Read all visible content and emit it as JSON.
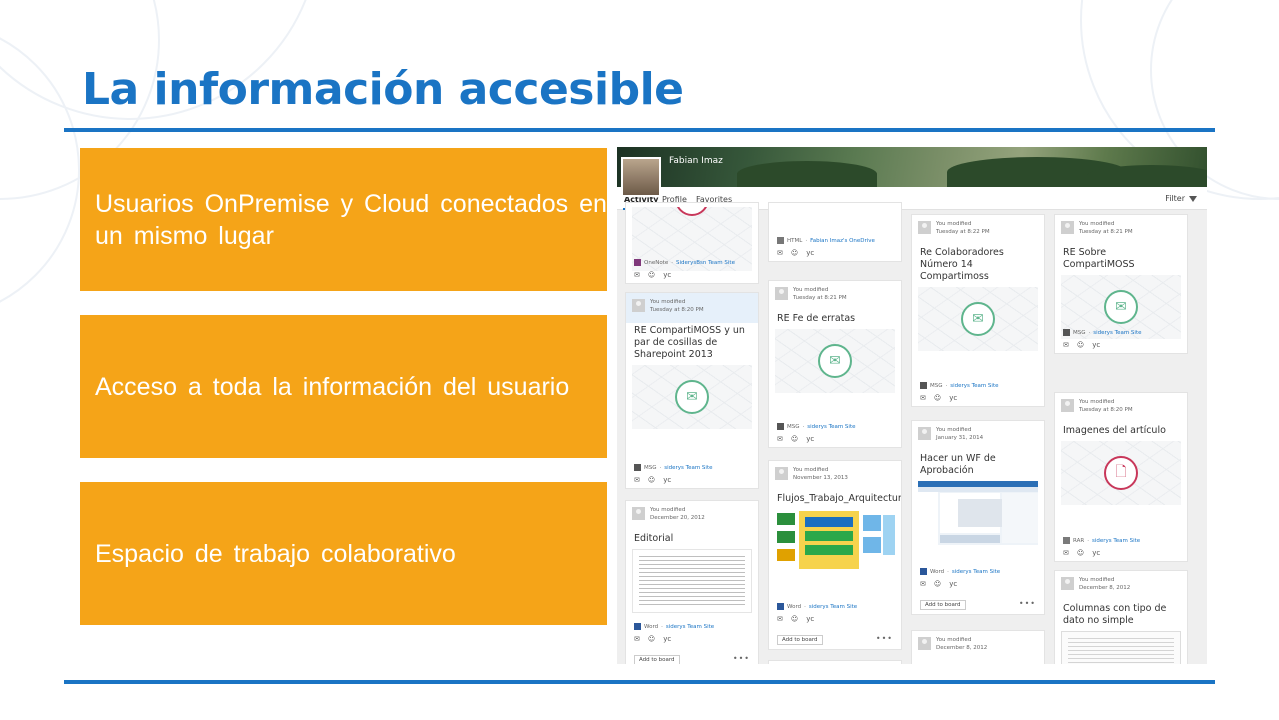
{
  "slide": {
    "title": "La información accesible",
    "colors": {
      "accent": "#1a74c4",
      "box": "#f5a418"
    },
    "boxes": [
      "Usuarios OnPremise y Cloud conectados en un mismo lugar",
      "Acceso a toda la información del usuario",
      "Espacio de trabajo colaborativo"
    ]
  },
  "profile": {
    "name": "Fabian Imaz",
    "tabs": [
      "Activity",
      "Profile",
      "Favorites"
    ],
    "filter_label": "Filter",
    "actions_glyph": "yc",
    "add_to_board": "Add to board",
    "more_glyph": "•••"
  },
  "columns": [
    [
      {
        "title": "",
        "modified": "",
        "date": "",
        "source_type": "OneNote",
        "source_icon": "onenote-icon",
        "site": "SiderysBsn Team Site",
        "preview": "partial-ring",
        "add": false
      },
      {
        "title": "RE CompartiMOSS y un par de cosillas de Sharepoint 2013",
        "modified": "You modified",
        "date": "Tuesday at 8:20 PM",
        "source_type": "MSG",
        "source_icon": "mail-icon",
        "site": "siderys Team Site",
        "preview": "mail-ring",
        "add": false,
        "highlight": true
      },
      {
        "title": "Editorial",
        "modified": "You modified",
        "date": "December 20, 2012",
        "source_type": "Word",
        "source_icon": "word-icon",
        "site": "siderys Team Site",
        "preview": "document",
        "add": true
      }
    ],
    [
      {
        "title": "",
        "modified": "",
        "date": "",
        "source_type": "HTML",
        "source_icon": "html-file-icon",
        "site": "Fabian Imaz's OneDrive",
        "preview": "none",
        "add": false
      },
      {
        "title": "RE Fe de erratas",
        "modified": "You modified",
        "date": "Tuesday at 8:21 PM",
        "source_type": "MSG",
        "source_icon": "mail-icon",
        "site": "siderys Team Site",
        "preview": "mail-ring",
        "add": false
      },
      {
        "title": "Flujos_Trabajo_Arquitectura",
        "modified": "You modified",
        "date": "November 13, 2013",
        "source_type": "Word",
        "source_icon": "word-icon",
        "site": "siderys Team Site",
        "preview": "flowchart",
        "add": true
      },
      {
        "title": "",
        "modified": "",
        "date": "",
        "source_type": "",
        "source_icon": "",
        "site": "",
        "preview": "none",
        "add": false
      }
    ],
    [
      {
        "title": "Re Colaboradores Número 14 Compartimoss",
        "modified": "You modified",
        "date": "Tuesday at 8:22 PM",
        "source_type": "MSG",
        "source_icon": "mail-icon",
        "site": "siderys Team Site",
        "preview": "mail-ring",
        "add": false
      },
      {
        "title": "Hacer un WF de Aprobación",
        "modified": "You modified",
        "date": "January 31, 2014",
        "source_type": "Word",
        "source_icon": "word-icon",
        "site": "siderys Team Site",
        "preview": "screenshot",
        "add": true
      },
      {
        "title": "",
        "modified": "You modified",
        "date": "December 8, 2012",
        "source_type": "",
        "source_icon": "",
        "site": "",
        "preview": "none",
        "add": false
      }
    ],
    [
      {
        "title": "RE Sobre CompartiMOSS",
        "modified": "You modified",
        "date": "Tuesday at 8:21 PM",
        "source_type": "MSG",
        "source_icon": "mail-icon",
        "site": "siderys Team Site",
        "preview": "mail-ring",
        "add": false
      },
      {
        "title": "Imagenes del artículo",
        "modified": "You modified",
        "date": "Tuesday at 8:20 PM",
        "source_type": "RAR",
        "source_icon": "archive-icon",
        "site": "siderys Team Site",
        "preview": "file-ring",
        "add": false
      },
      {
        "title": "Columnas con tipo de dato no simple",
        "modified": "You modified",
        "date": "December 8, 2012",
        "source_type": "",
        "source_icon": "",
        "site": "",
        "preview": "code",
        "add": false
      }
    ]
  ]
}
